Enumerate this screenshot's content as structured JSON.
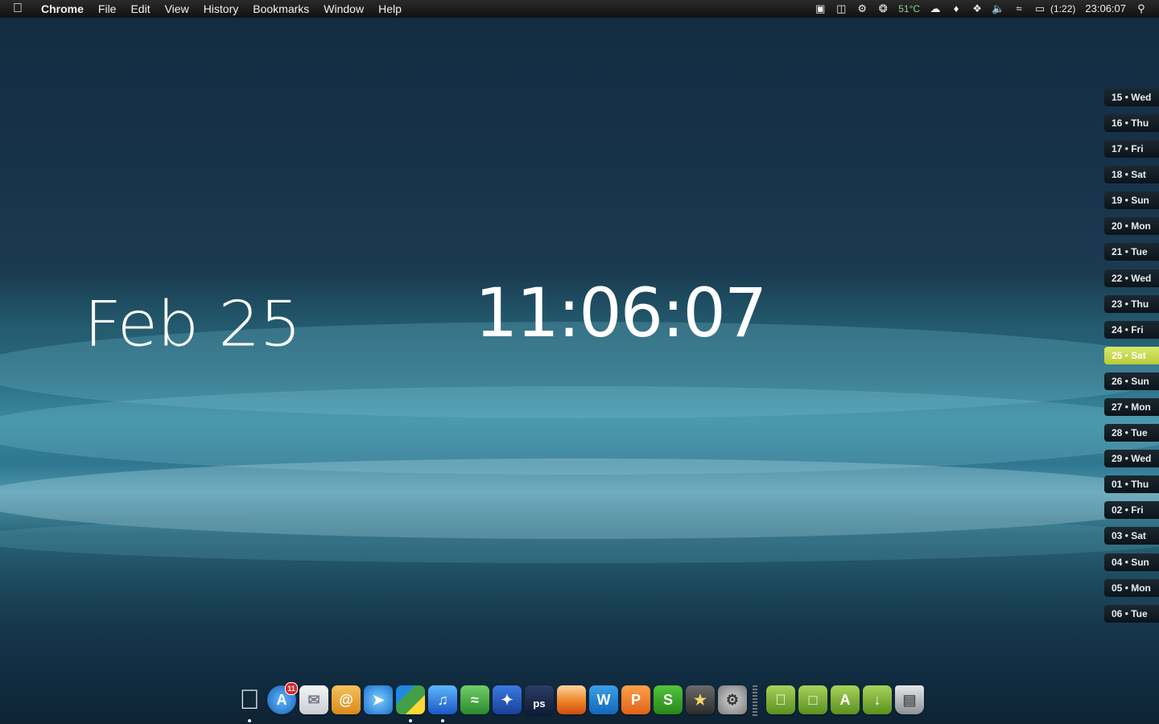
{
  "menubar": {
    "apple_icon": "apple-logo-icon",
    "app_name": "Chrome",
    "items": [
      "File",
      "Edit",
      "View",
      "History",
      "Bookmarks",
      "Window",
      "Help"
    ],
    "temperature": "51°C",
    "battery_time": "(1:22)",
    "clock": "23:06:07"
  },
  "widget": {
    "date": "Feb 25",
    "time": "11:06:07"
  },
  "calendar": {
    "days": [
      {
        "num": "15",
        "dow": "Wed"
      },
      {
        "num": "16",
        "dow": "Thu"
      },
      {
        "num": "17",
        "dow": "Fri"
      },
      {
        "num": "18",
        "dow": "Sat"
      },
      {
        "num": "19",
        "dow": "Sun"
      },
      {
        "num": "20",
        "dow": "Mon"
      },
      {
        "num": "21",
        "dow": "Tue"
      },
      {
        "num": "22",
        "dow": "Wed"
      },
      {
        "num": "23",
        "dow": "Thu"
      },
      {
        "num": "24",
        "dow": "Fri"
      },
      {
        "num": "25",
        "dow": "Sat"
      },
      {
        "num": "26",
        "dow": "Sun"
      },
      {
        "num": "27",
        "dow": "Mon"
      },
      {
        "num": "28",
        "dow": "Tue"
      },
      {
        "num": "29",
        "dow": "Wed"
      },
      {
        "num": "01",
        "dow": "Thu"
      },
      {
        "num": "02",
        "dow": "Fri"
      },
      {
        "num": "03",
        "dow": "Sat"
      },
      {
        "num": "04",
        "dow": "Sun"
      },
      {
        "num": "05",
        "dow": "Mon"
      },
      {
        "num": "06",
        "dow": "Tue"
      }
    ],
    "today_index": 10
  },
  "dock": {
    "app_store_badge": "11",
    "photoshop_label": "ps"
  }
}
